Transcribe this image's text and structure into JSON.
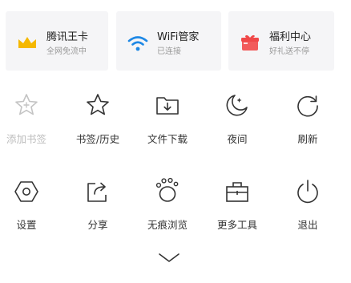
{
  "cards": [
    {
      "title": "腾讯王卡",
      "subtitle": "全网免流中",
      "icon": "crown-icon",
      "color": "#f5b800"
    },
    {
      "title": "WiFi管家",
      "subtitle": "已连接",
      "icon": "wifi-icon",
      "color": "#1e88e5"
    },
    {
      "title": "福利中心",
      "subtitle": "好礼送不停",
      "icon": "gift-icon",
      "color": "#f25b5b"
    }
  ],
  "grid": {
    "row1": [
      {
        "label": "添加书签",
        "icon": "add-bookmark-icon",
        "disabled": true
      },
      {
        "label": "书签/历史",
        "icon": "star-icon",
        "disabled": false
      },
      {
        "label": "文件下载",
        "icon": "download-folder-icon",
        "disabled": false
      },
      {
        "label": "夜间",
        "icon": "moon-icon",
        "disabled": false
      },
      {
        "label": "刷新",
        "icon": "refresh-icon",
        "disabled": false
      }
    ],
    "row2": [
      {
        "label": "设置",
        "icon": "settings-hexagon-icon",
        "disabled": false
      },
      {
        "label": "分享",
        "icon": "share-icon",
        "disabled": false
      },
      {
        "label": "无痕浏览",
        "icon": "footprint-icon",
        "disabled": false
      },
      {
        "label": "更多工具",
        "icon": "toolbox-icon",
        "disabled": false
      },
      {
        "label": "退出",
        "icon": "power-icon",
        "disabled": false
      }
    ]
  },
  "collapse_icon": "chevron-down-icon"
}
